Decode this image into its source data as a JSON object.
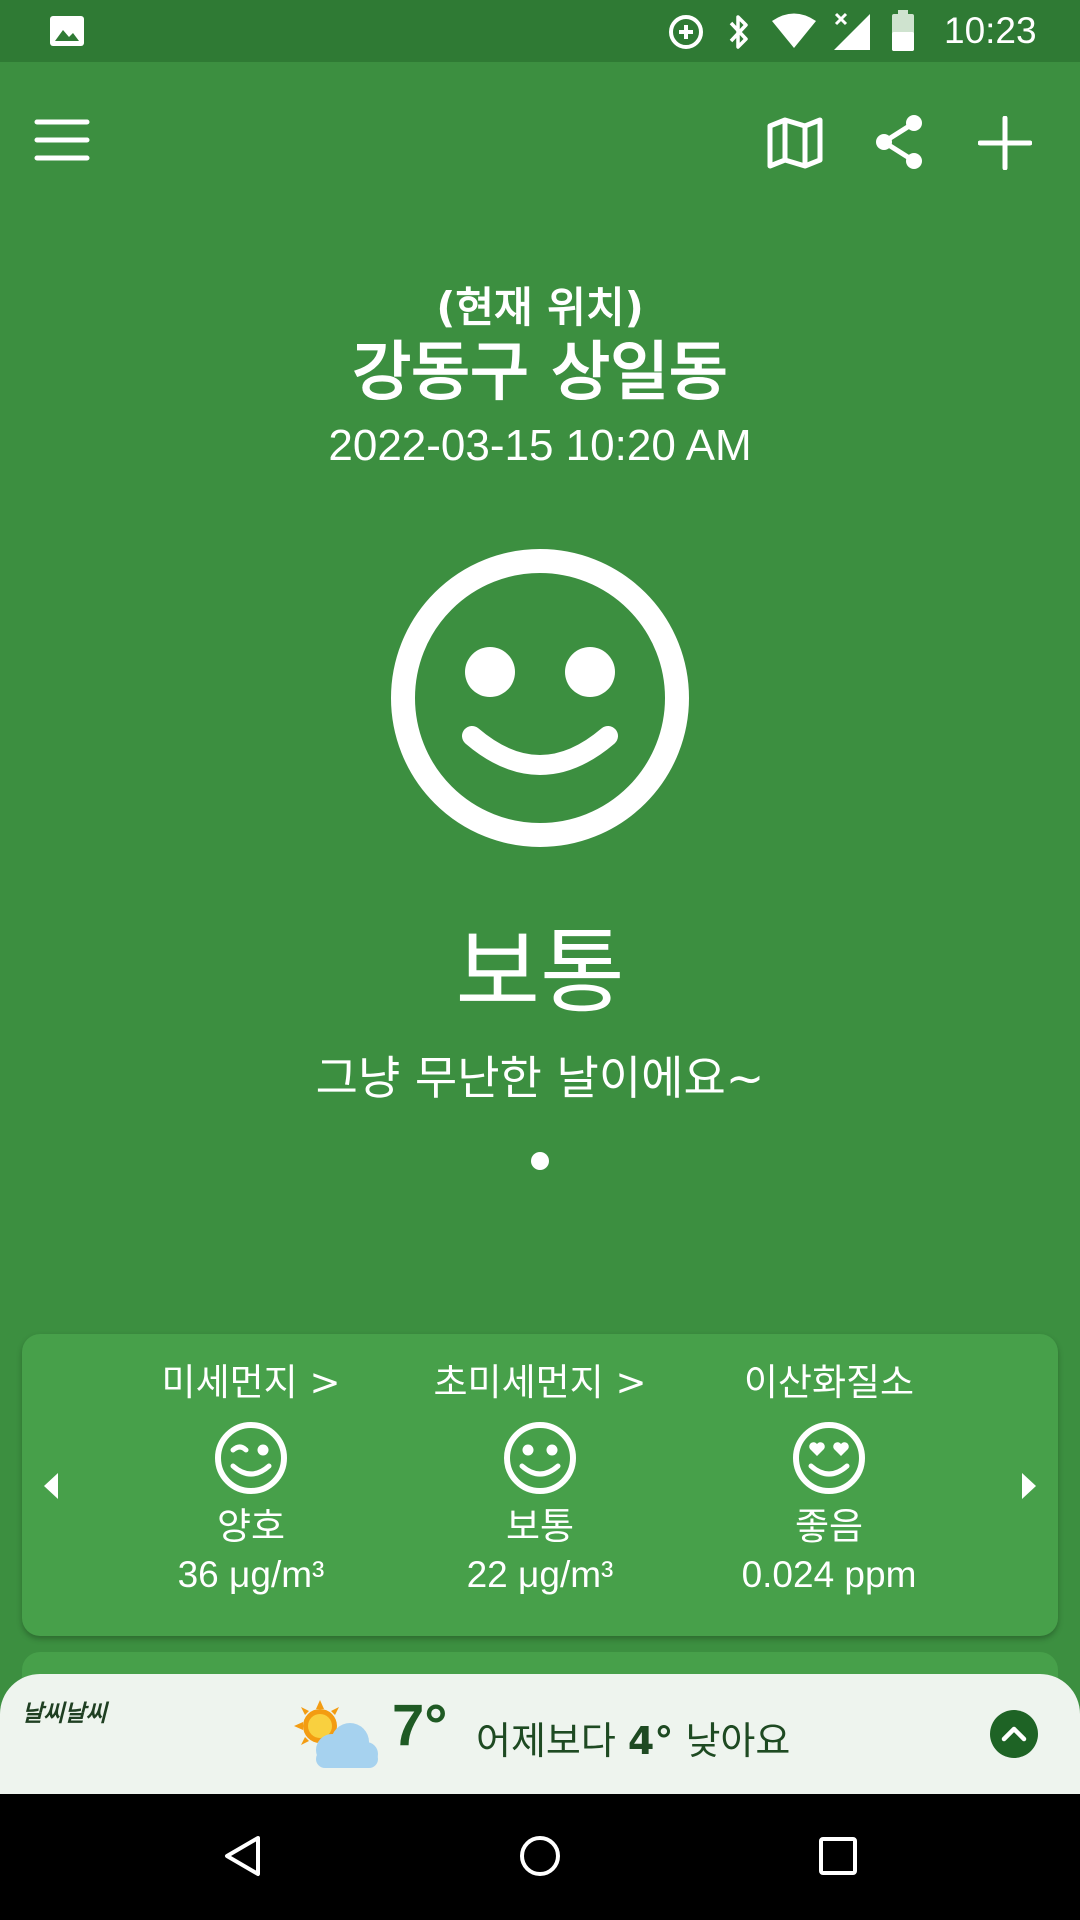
{
  "status_bar": {
    "time": "10:23",
    "icons": [
      "image-icon",
      "data-saver-icon",
      "bluetooth-icon",
      "wifi-icon",
      "cell-signal-icon",
      "battery-icon"
    ]
  },
  "toolbar": {
    "icons": [
      "menu-icon",
      "map-icon",
      "share-icon",
      "add-icon"
    ]
  },
  "location": {
    "label": "(현재 위치)",
    "name": "강동구 상일동",
    "datetime": "2022-03-15 10:20 AM"
  },
  "summary": {
    "status": "보통",
    "message": "그냥 무난한 날이에요~",
    "face_icon": "smile-face-icon"
  },
  "pollutants": [
    {
      "title": "미세먼지 >",
      "status": "양호",
      "value": "36 μg/m³",
      "face_icon": "wink-face-icon"
    },
    {
      "title": "초미세먼지 >",
      "status": "보통",
      "value": "22 μg/m³",
      "face_icon": "smile-face-icon"
    },
    {
      "title": "이산화질소",
      "status": "좋음",
      "value": "0.024 ppm",
      "face_icon": "heart-eyes-face-icon"
    }
  ],
  "weather": {
    "logo": "날씨날씨",
    "temp": "7°",
    "msg_pre": "어제보다 ",
    "msg_diff": "4°",
    "msg_post": " 낮아요",
    "icon": "partly-cloudy-icon"
  },
  "colors": {
    "background": "#3c8f40",
    "status_bar": "#2f7a34",
    "card": "#47a04a",
    "weather_bar": "#eef4ee"
  }
}
